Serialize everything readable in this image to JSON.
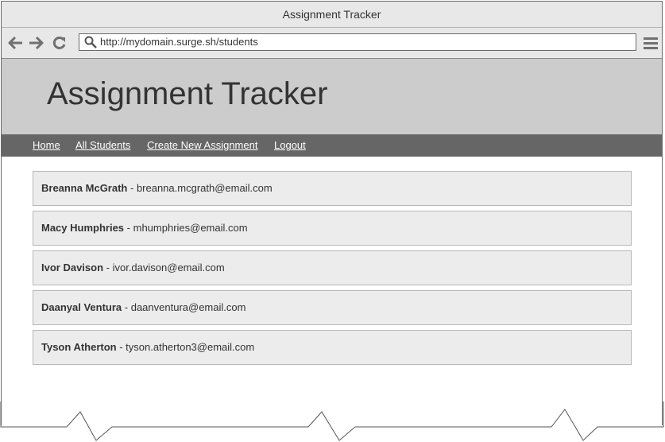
{
  "window": {
    "title": "Assignment Tracker"
  },
  "toolbar": {
    "url": "http://mydomain.surge.sh/students",
    "icons": [
      "back-arrow-icon",
      "forward-arrow-icon",
      "reload-icon",
      "search-icon",
      "hamburger-menu-icon"
    ]
  },
  "header": {
    "title": "Assignment Tracker"
  },
  "nav": {
    "items": [
      {
        "label": "Home"
      },
      {
        "label": "All Students"
      },
      {
        "label": "Create New Assignment"
      },
      {
        "label": "Logout"
      }
    ]
  },
  "students": [
    {
      "name": "Breanna McGrath",
      "separator": " - ",
      "email": "breanna.mcgrath@email.com"
    },
    {
      "name": "Macy Humphries",
      "separator": " - ",
      "email": "mhumphries@email.com"
    },
    {
      "name": "Ivor Davison",
      "separator": " - ",
      "email": "ivor.davison@email.com"
    },
    {
      "name": "Daanyal Ventura",
      "separator": " - ",
      "email": "daanventura@email.com"
    },
    {
      "name": "Tyson Atherton",
      "separator": " - ",
      "email": "tyson.atherton3@email.com"
    }
  ],
  "colors": {
    "header_bg": "#cccccc",
    "navbar_bg": "#666666",
    "list_item_bg": "#ececec",
    "chrome_bg": "#e8e8e8"
  }
}
